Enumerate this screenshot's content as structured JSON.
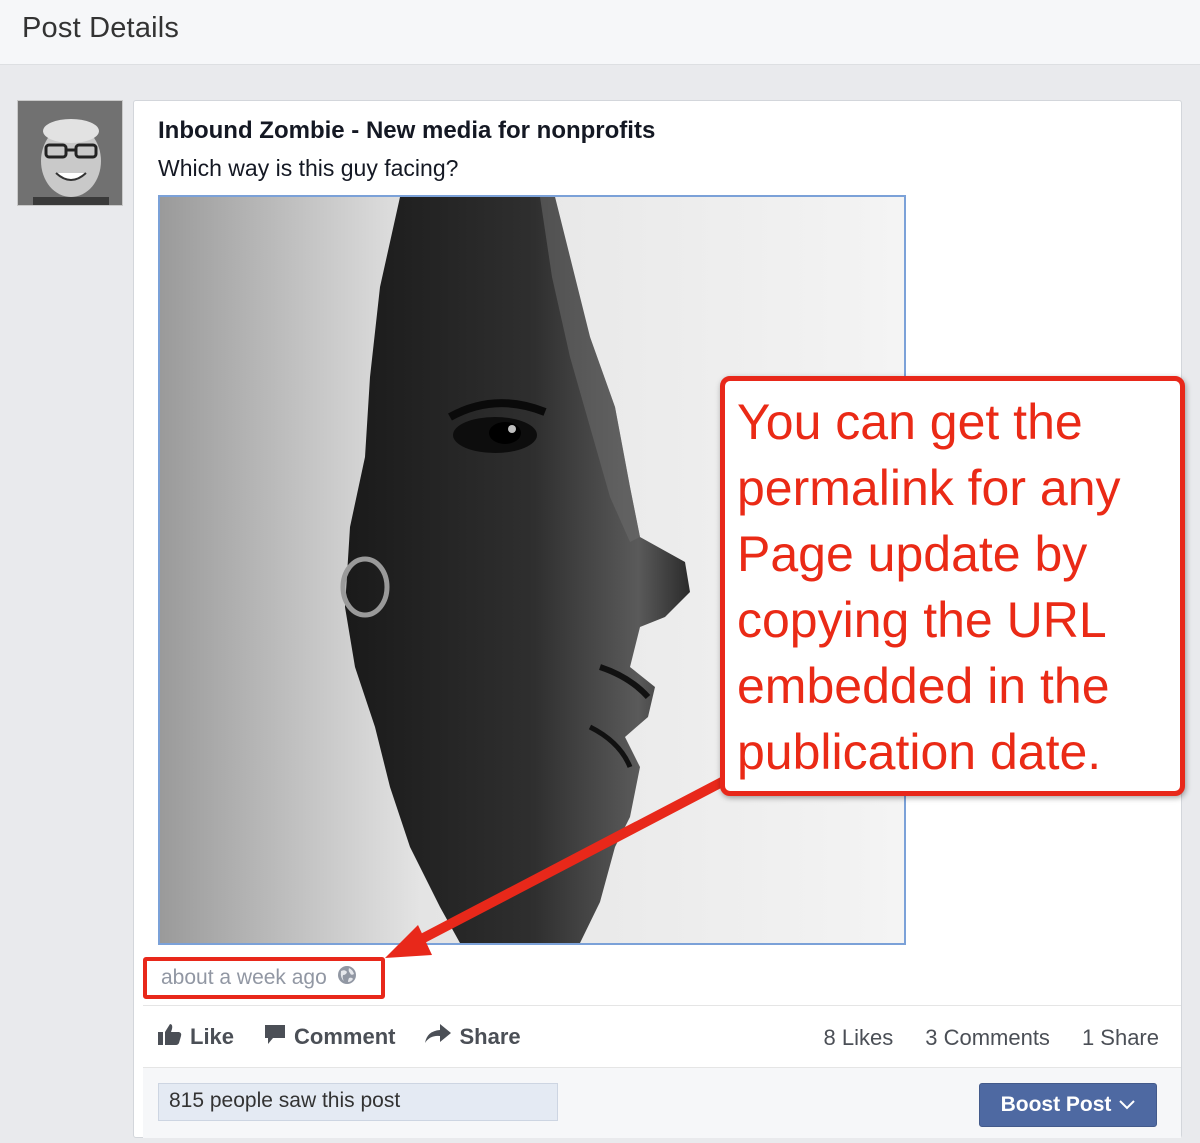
{
  "header": {
    "title": "Post Details"
  },
  "post": {
    "author": "Inbound Zombie - New media for nonprofits",
    "message": "Which way is this guy facing?",
    "timestamp": "about a week ago",
    "privacy_icon": "globe-icon"
  },
  "actions": {
    "like_label": "Like",
    "comment_label": "Comment",
    "share_label": "Share"
  },
  "stats": {
    "likes": "8 Likes",
    "comments": "3 Comments",
    "shares": "1 Share"
  },
  "footer": {
    "reach": "815 people saw this post",
    "boost_label": "Boost Post"
  },
  "annotation": {
    "text": "You can get the\npermalink for any\nPage update by\ncopying the URL\nembedded in the\npublication date.",
    "color": "#e8281a"
  }
}
